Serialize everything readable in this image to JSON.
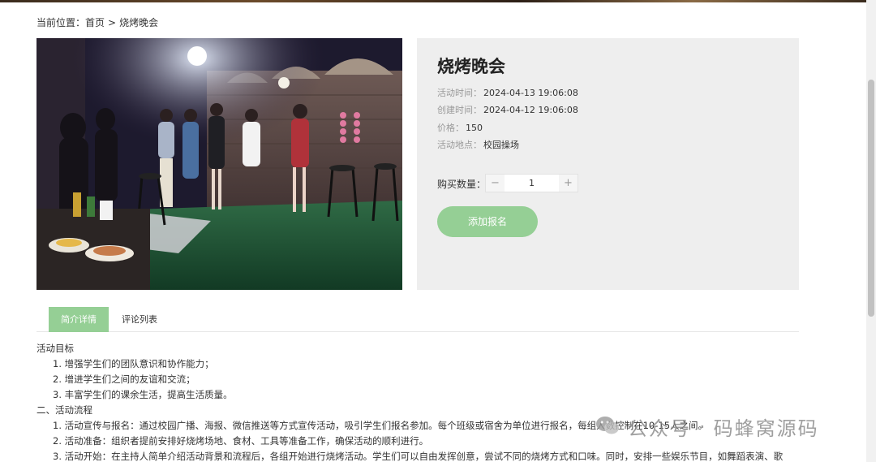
{
  "breadcrumb": {
    "label": "当前位置：",
    "home": "首页",
    "separator": ">",
    "current": "烧烤晚会"
  },
  "event": {
    "title": "烧烤晚会",
    "activity_time_label": "活动时间：",
    "activity_time": "2024-04-13 19:06:08",
    "created_time_label": "创建时间：",
    "created_time": "2024-04-12 19:06:08",
    "price_label": "价格：",
    "price": "150",
    "location_label": "活动地点：",
    "location": "校园操场"
  },
  "purchase": {
    "qty_label": "购买数量：",
    "minus": "−",
    "quantity": "1",
    "plus": "+",
    "signup_button": "添加报名"
  },
  "tabs": {
    "detail": "简介详情",
    "comments": "评论列表"
  },
  "content": {
    "lines": [
      "活动目标",
      "1. 增强学生们的团队意识和协作能力；",
      "2. 增进学生们之间的友谊和交流；",
      "3. 丰富学生们的课余生活，提高生活质量。",
      "二、活动流程",
      "1. 活动宣传与报名：通过校园广播、海报、微信推送等方式宣传活动，吸引学生们报名参加。每个班级或宿舍为单位进行报名，每组人数控制在10-15人之间。",
      "2. 活动准备：组织者提前安排好烧烤场地、食材、工具等准备工作，确保活动的顺利进行。",
      "3. 活动开始：在主持人简单介绍活动背景和流程后，各组开始进行烧烤活动。学生们可以自由发挥创意，尝试不同的烧烤方式和口味。同时，安排一些娱乐节目，如舞蹈表演、歌"
    ]
  },
  "watermark": {
    "text1": "公众号",
    "dot": "·",
    "text2": "码蜂窝源码",
    "icon": "wechat-icon"
  },
  "colors": {
    "accent": "#95cf95",
    "panel": "#eeeeee"
  }
}
